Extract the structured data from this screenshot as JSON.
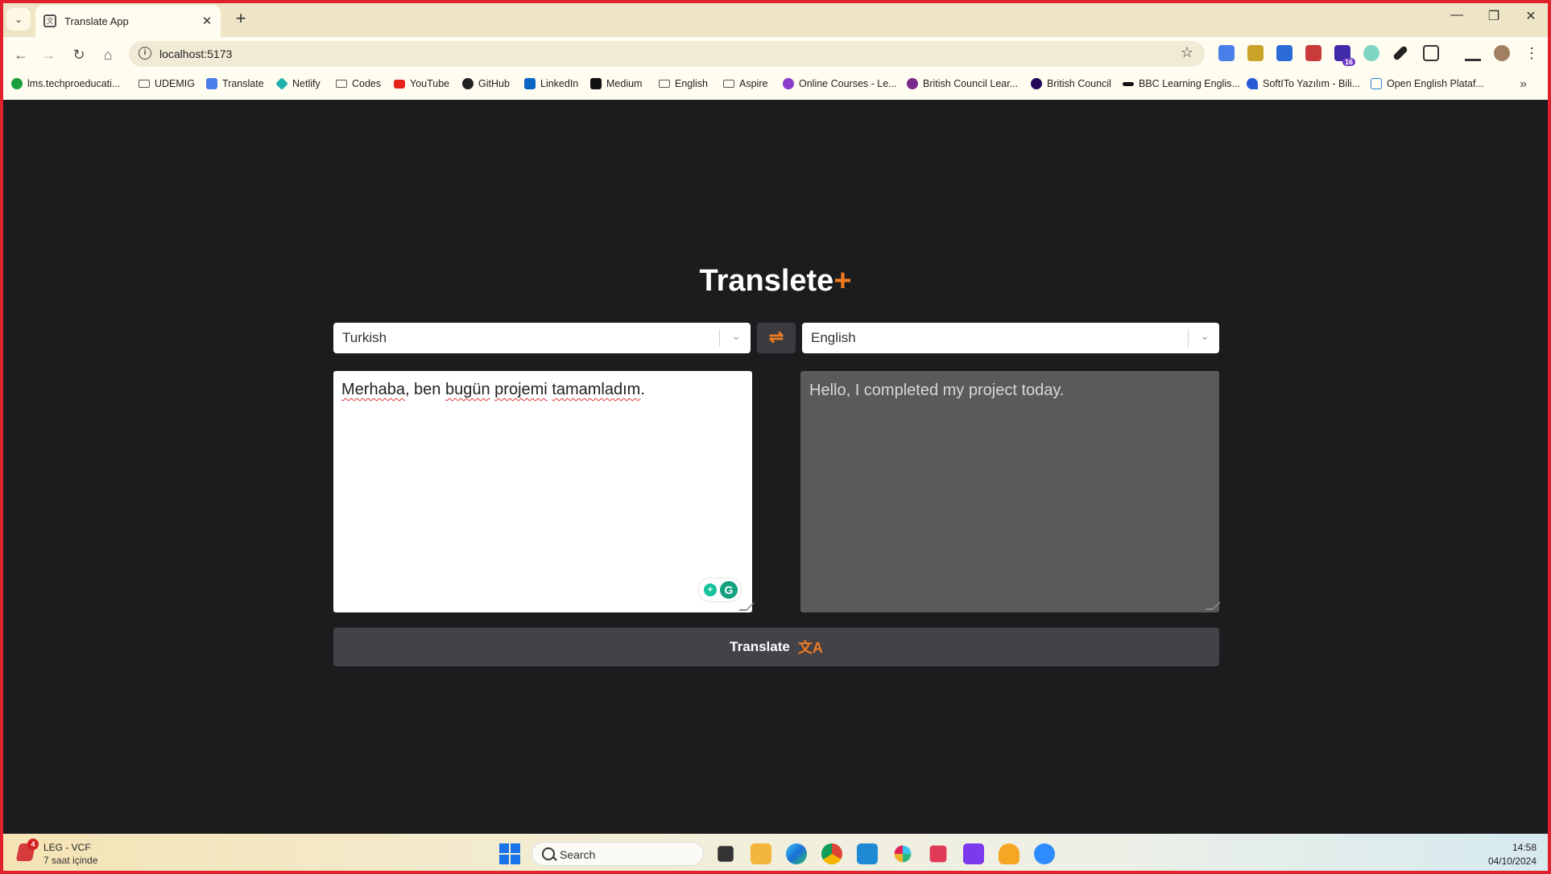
{
  "browser": {
    "tab_title": "Translate App",
    "url": "localhost:5173",
    "extension_badge": "16",
    "bookmarks": [
      {
        "label": "lms.techproeducati...",
        "icon": "check-icon",
        "color": "#1a9e3a"
      },
      {
        "label": "UDEMIG",
        "icon": "folder-icon",
        "color": "#555555"
      },
      {
        "label": "Translate",
        "icon": "translate-icon",
        "color": "#4a7ee8"
      },
      {
        "label": "Netlify",
        "icon": "netlify-icon",
        "color": "#20b2aa"
      },
      {
        "label": "Codes",
        "icon": "folder-icon",
        "color": "#555555"
      },
      {
        "label": "YouTube",
        "icon": "youtube-icon",
        "color": "#e62117"
      },
      {
        "label": "GitHub",
        "icon": "github-icon",
        "color": "#222222"
      },
      {
        "label": "LinkedIn",
        "icon": "linkedin-icon",
        "color": "#0a66c2"
      },
      {
        "label": "Medium",
        "icon": "medium-icon",
        "color": "#111111"
      },
      {
        "label": "English",
        "icon": "folder-icon",
        "color": "#555555"
      },
      {
        "label": "Aspire",
        "icon": "folder-icon",
        "color": "#555555"
      },
      {
        "label": "Online Courses - Le...",
        "icon": "courses-icon",
        "color": "#8b3cc9"
      },
      {
        "label": "British Council Lear...",
        "icon": "british-council-icon",
        "color": "#7b2a8a"
      },
      {
        "label": "British Council",
        "icon": "british-council-icon",
        "color": "#23085a"
      },
      {
        "label": "BBC Learning Englis...",
        "icon": "bbc-icon",
        "color": "#111111"
      },
      {
        "label": "SoftITo Yazılım - Bili...",
        "icon": "softito-icon",
        "color": "#2a5bd7"
      },
      {
        "label": "Open English Plataf...",
        "icon": "open-english-icon",
        "color": "#2b7de0"
      }
    ]
  },
  "app": {
    "title": "Translete",
    "title_suffix": "+",
    "source_language": "Turkish",
    "target_language": "English",
    "source_text_parts": [
      "Merhaba",
      ", ben ",
      "bugün",
      " ",
      "projemi",
      " ",
      "tamamladım",
      "."
    ],
    "target_text": "Hello, I completed my project today.",
    "translate_button": "Translate",
    "accent_color": "#ef7b20"
  },
  "taskbar": {
    "notification_title": "LEG - VCF",
    "notification_sub": "7 saat içinde",
    "notification_count": "4",
    "search_placeholder": "Search",
    "time": "14:58",
    "date": "04/10/2024"
  }
}
